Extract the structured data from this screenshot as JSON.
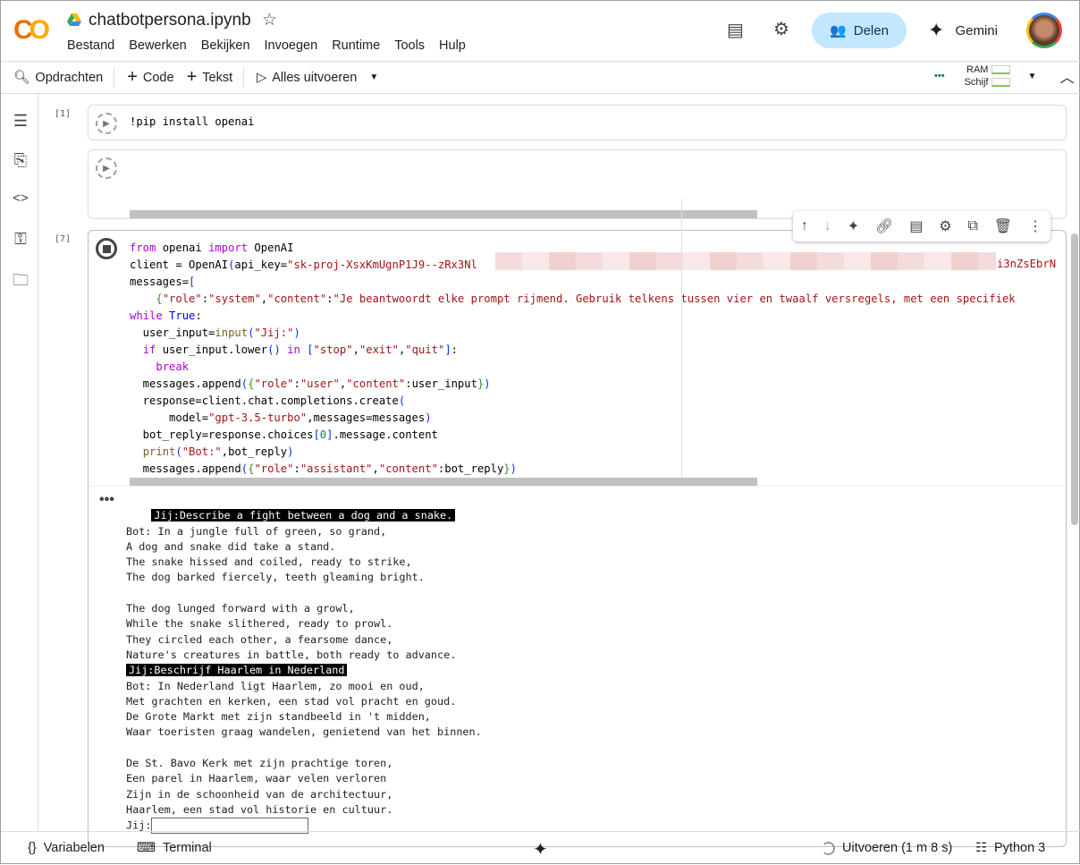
{
  "app": {
    "logo": "CO",
    "title": "chatbotpersona.ipynb"
  },
  "menu": [
    "Bestand",
    "Bewerken",
    "Bekijken",
    "Invoegen",
    "Runtime",
    "Tools",
    "Hulp"
  ],
  "header": {
    "share": "Delen",
    "gemini": "Gemini"
  },
  "toolbar": {
    "commands": "Opdrachten",
    "code": "Code",
    "text": "Tekst",
    "run_all": "Alles uitvoeren",
    "ram": "RAM",
    "disk": "Schijf"
  },
  "cells": [
    {
      "number": "[1]",
      "code": "!pip install openai"
    },
    {
      "number": "",
      "code": ""
    },
    {
      "number": "[7]"
    }
  ],
  "code_lines": [
    [
      [
        "from",
        "kw"
      ],
      [
        " openai ",
        ""
      ],
      [
        "import",
        "kw"
      ],
      [
        " OpenAI",
        ""
      ]
    ],
    [
      [
        "client = OpenAI",
        ""
      ],
      [
        "(",
        "br"
      ],
      [
        "api_key=",
        ""
      ],
      [
        "\"sk-proj-XsxKmUgnP1J9--zRx3Nl",
        "st"
      ]
    ],
    [
      [
        "messages=",
        ""
      ],
      [
        "[",
        "br"
      ]
    ],
    [
      [
        "    ",
        ""
      ],
      [
        "{",
        "br2"
      ],
      [
        "\"role\"",
        "st"
      ],
      [
        ":",
        ""
      ],
      [
        "\"system\"",
        "st"
      ],
      [
        ",",
        ""
      ],
      [
        "\"content\"",
        "st"
      ],
      [
        ":",
        ""
      ],
      [
        "\"Je beantwoordt elke prompt rijmend. Gebruik telkens tussen vier en twaalf versregels, met een specifiek",
        "st"
      ]
    ],
    [
      [
        "while",
        "kw"
      ],
      [
        " ",
        ""
      ],
      [
        "True",
        "bl"
      ],
      [
        ":",
        ""
      ]
    ],
    [
      [
        "  user_input=",
        ""
      ],
      [
        "input",
        "fn"
      ],
      [
        "(",
        "br"
      ],
      [
        "\"Jij:\"",
        "st"
      ],
      [
        ")",
        "br"
      ]
    ],
    [
      [
        "  ",
        ""
      ],
      [
        "if",
        "kw"
      ],
      [
        " user_input.lower",
        ""
      ],
      [
        "()",
        "br"
      ],
      [
        " ",
        ""
      ],
      [
        "in",
        "kw"
      ],
      [
        " ",
        ""
      ],
      [
        "[",
        "br"
      ],
      [
        "\"stop\"",
        "st"
      ],
      [
        ",",
        ""
      ],
      [
        "\"exit\"",
        "st"
      ],
      [
        ",",
        ""
      ],
      [
        "\"quit\"",
        "st"
      ],
      [
        "]",
        "br"
      ],
      [
        ":",
        ""
      ]
    ],
    [
      [
        "    ",
        ""
      ],
      [
        "break",
        "kw"
      ]
    ],
    [
      [
        "  messages.append",
        ""
      ],
      [
        "(",
        "br"
      ],
      [
        "{",
        "br2"
      ],
      [
        "\"role\"",
        "st"
      ],
      [
        ":",
        ""
      ],
      [
        "\"user\"",
        "st"
      ],
      [
        ",",
        ""
      ],
      [
        "\"content\"",
        "st"
      ],
      [
        ":user_input",
        ""
      ],
      [
        "}",
        "br2"
      ],
      [
        ")",
        "br"
      ]
    ],
    [
      [
        "  response=client.chat.completions.create",
        ""
      ],
      [
        "(",
        "br"
      ]
    ],
    [
      [
        "      model=",
        ""
      ],
      [
        "\"gpt-3.5-turbo\"",
        "st"
      ],
      [
        ",messages=messages",
        ""
      ],
      [
        ")",
        "br"
      ]
    ],
    [
      [
        "  bot_reply=response.choices",
        ""
      ],
      [
        "[",
        "br"
      ],
      [
        "0",
        "nm"
      ],
      [
        "]",
        "br"
      ],
      [
        ".message.content",
        ""
      ]
    ],
    [
      [
        "  ",
        ""
      ],
      [
        "print",
        "fn"
      ],
      [
        "(",
        "br"
      ],
      [
        "\"Bot:\"",
        "st"
      ],
      [
        ",bot_reply",
        ""
      ],
      [
        ")",
        "br"
      ]
    ],
    [
      [
        "  messages.append",
        ""
      ],
      [
        "(",
        "br"
      ],
      [
        "{",
        "br2"
      ],
      [
        "\"role\"",
        "st"
      ],
      [
        ":",
        ""
      ],
      [
        "\"assistant\"",
        "st"
      ],
      [
        ",",
        ""
      ],
      [
        "\"content\"",
        "st"
      ],
      [
        ":bot_reply",
        ""
      ],
      [
        "}",
        "br2"
      ],
      [
        ")",
        "br"
      ]
    ]
  ],
  "api_key_tail": "i3nZsEbrN",
  "output": {
    "prompt1": "Jij:Describe a fight between a dog and a snake.",
    "reply1": "Bot: In a jungle full of green, so grand,\nA dog and snake did take a stand.\nThe snake hissed and coiled, ready to strike,\nThe dog barked fiercely, teeth gleaming bright.\n\nThe dog lunged forward with a growl,\nWhile the snake slithered, ready to prowl.\nThey circled each other, a fearsome dance,\nNature's creatures in battle, both ready to advance.",
    "prompt2": "Jij:Beschrijf Haarlem in Nederland",
    "reply2": "Bot: In Nederland ligt Haarlem, zo mooi en oud,\nMet grachten en kerken, een stad vol pracht en goud.\nDe Grote Markt met zijn standbeeld in 't midden,\nWaar toeristen graag wandelen, genietend van het binnen.\n\nDe St. Bavo Kerk met zijn prachtige toren,\nEen parel in Haarlem, waar velen verloren\nZijn in de schoonheid van de architectuur,\nHaarlem, een stad vol historie en cultuur.",
    "input_prompt": "Jij:",
    "input_value": ""
  },
  "footer": {
    "variables": "Variabelen",
    "terminal": "Terminal",
    "status": "Uitvoeren (1 m 8 s)",
    "kernel": "Python 3"
  }
}
